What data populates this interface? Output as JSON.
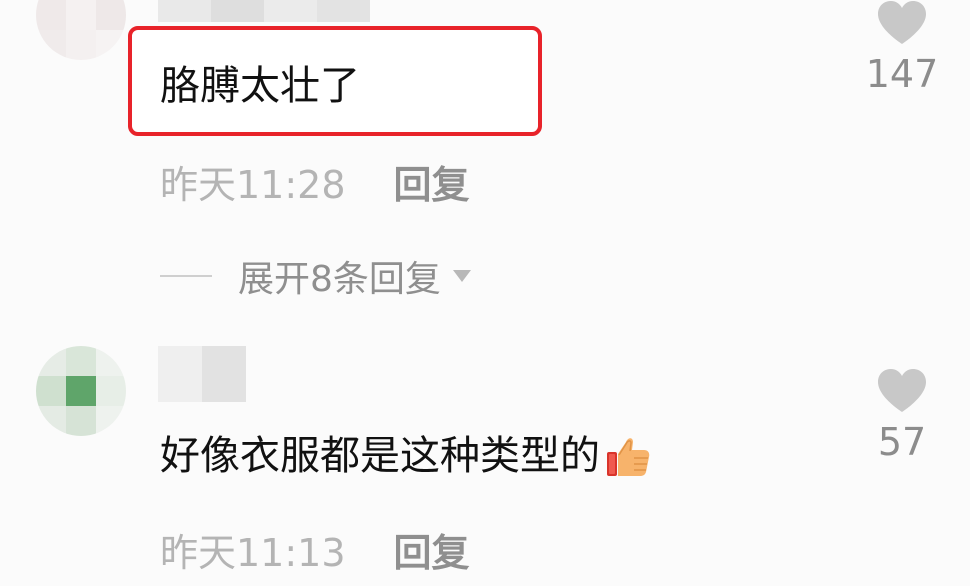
{
  "comments": [
    {
      "text": "胳膊太壮了",
      "time": "昨天11:28",
      "reply_label": "回复",
      "likes": "147",
      "expand_label": "展开8条回复",
      "highlighted": true
    },
    {
      "text": "好像衣服都是这种类型的",
      "emoji": "thumbs-up-emoji",
      "time": "昨天11:13",
      "reply_label": "回复",
      "likes": "57"
    }
  ],
  "icons": {
    "like": "heart-icon",
    "expand": "caret-down-icon"
  },
  "colors": {
    "highlight_border": "#e8232a",
    "heart": "#c8c8c8"
  }
}
